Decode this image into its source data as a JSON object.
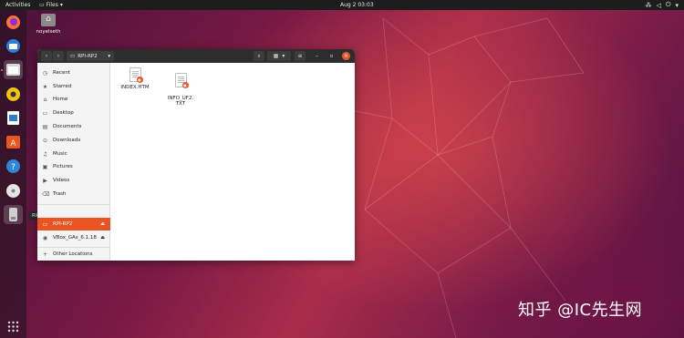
{
  "topbar": {
    "activities": "Activities",
    "app_menu": "Files",
    "clock": "Aug 2  03:03",
    "tray_icons": [
      "network-icon",
      "volume-icon",
      "power-icon",
      "chevron-down-icon"
    ]
  },
  "desktop": {
    "icon_label": "noyelseth"
  },
  "dock": {
    "items": [
      "firefox",
      "thunderbird",
      "files",
      "rhythmbox",
      "libreoffice-writer",
      "ubuntu-software",
      "help",
      "optical-disc",
      "usb-drive"
    ],
    "tooltip": "RPI-RP2",
    "show_apps": "show-applications"
  },
  "window": {
    "path_label": "RPI-RP2",
    "sidebar": {
      "items": [
        {
          "label": "Recent",
          "icon": "clock-icon"
        },
        {
          "label": "Starred",
          "icon": "star-icon"
        },
        {
          "label": "Home",
          "icon": "home-icon"
        },
        {
          "label": "Desktop",
          "icon": "desktop-icon"
        },
        {
          "label": "Documents",
          "icon": "documents-icon"
        },
        {
          "label": "Downloads",
          "icon": "downloads-icon"
        },
        {
          "label": "Music",
          "icon": "music-icon"
        },
        {
          "label": "Pictures",
          "icon": "pictures-icon"
        },
        {
          "label": "Videos",
          "icon": "videos-icon"
        },
        {
          "label": "Trash",
          "icon": "trash-icon"
        }
      ],
      "devices": [
        {
          "label": "RPI-RP2",
          "icon": "drive-icon",
          "selected": true
        },
        {
          "label": "VBox_GAs_6.1.18",
          "icon": "disc-icon",
          "selected": false
        }
      ],
      "other_locations": "Other Locations"
    },
    "files": [
      {
        "name": "INDEX.HTM"
      },
      {
        "name": "INFO_UF2.\nTXT"
      }
    ]
  },
  "watermark": "知乎 @IC先生网",
  "colors": {
    "accent": "#e95420",
    "topbar": "#1d1d1d",
    "headerbar": "#2d2d2d"
  }
}
